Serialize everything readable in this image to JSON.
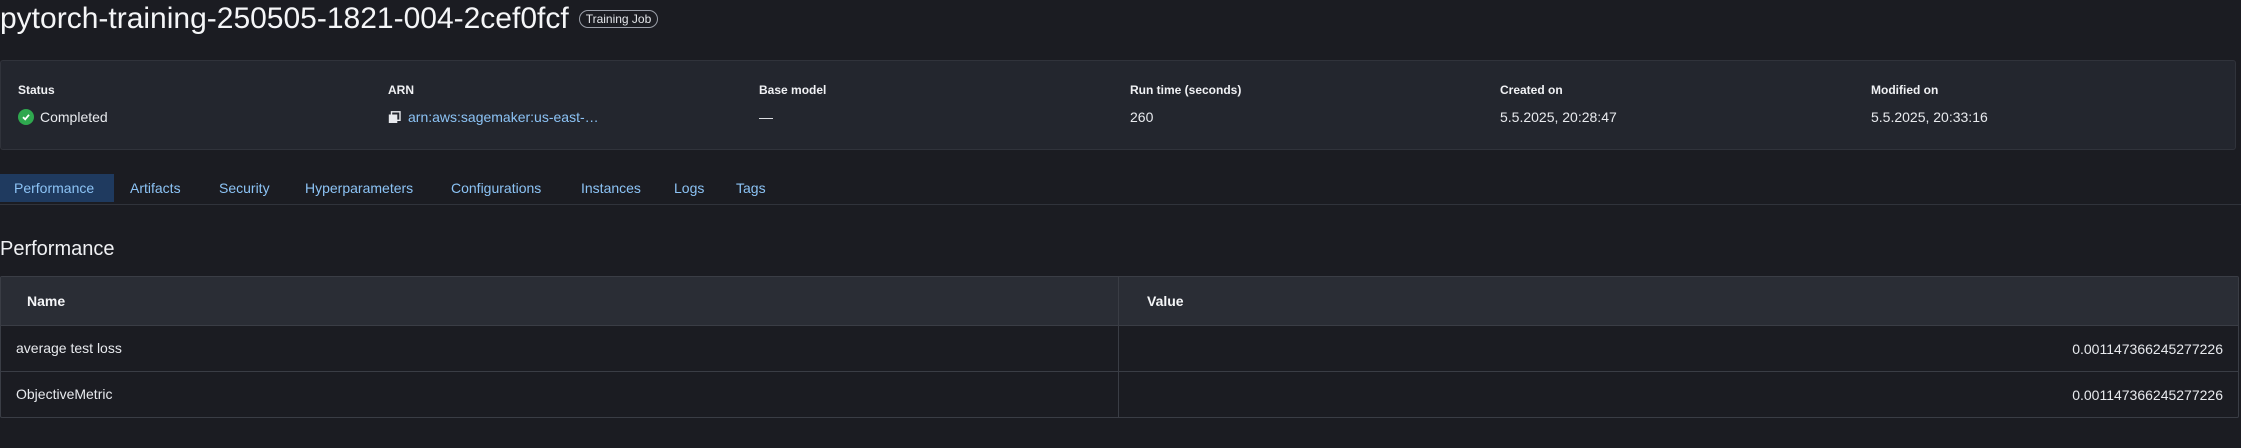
{
  "header": {
    "title": "pytorch-training-250505-1821-004-2cef0fcf",
    "badge": "Training Job"
  },
  "summary": {
    "status": {
      "label": "Status",
      "value": "Completed",
      "color": "#2fa84f"
    },
    "arn": {
      "label": "ARN",
      "value": "arn:aws:sagemaker:us-east-…"
    },
    "base_model": {
      "label": "Base model",
      "value": "—"
    },
    "run_time": {
      "label": "Run time (seconds)",
      "value": "260"
    },
    "created_on": {
      "label": "Created on",
      "value": "5.5.2025, 20:28:47"
    },
    "modified_on": {
      "label": "Modified on",
      "value": "5.5.2025, 20:33:16"
    }
  },
  "tabs": [
    {
      "label": "Performance",
      "active": true
    },
    {
      "label": "Artifacts"
    },
    {
      "label": "Security"
    },
    {
      "label": "Hyperparameters"
    },
    {
      "label": "Configurations"
    },
    {
      "label": "Instances"
    },
    {
      "label": "Logs"
    },
    {
      "label": "Tags"
    }
  ],
  "performance": {
    "title": "Performance",
    "columns": {
      "name": "Name",
      "value": "Value"
    },
    "rows": [
      {
        "name": "average test loss",
        "value": "0.001147366245277226"
      },
      {
        "name": "ObjectiveMetric",
        "value": "0.001147366245277226"
      }
    ]
  },
  "colors": {
    "accent": "#8cc3f5",
    "active_tab_bg": "#1f3a5f",
    "background": "#1b1c22"
  }
}
